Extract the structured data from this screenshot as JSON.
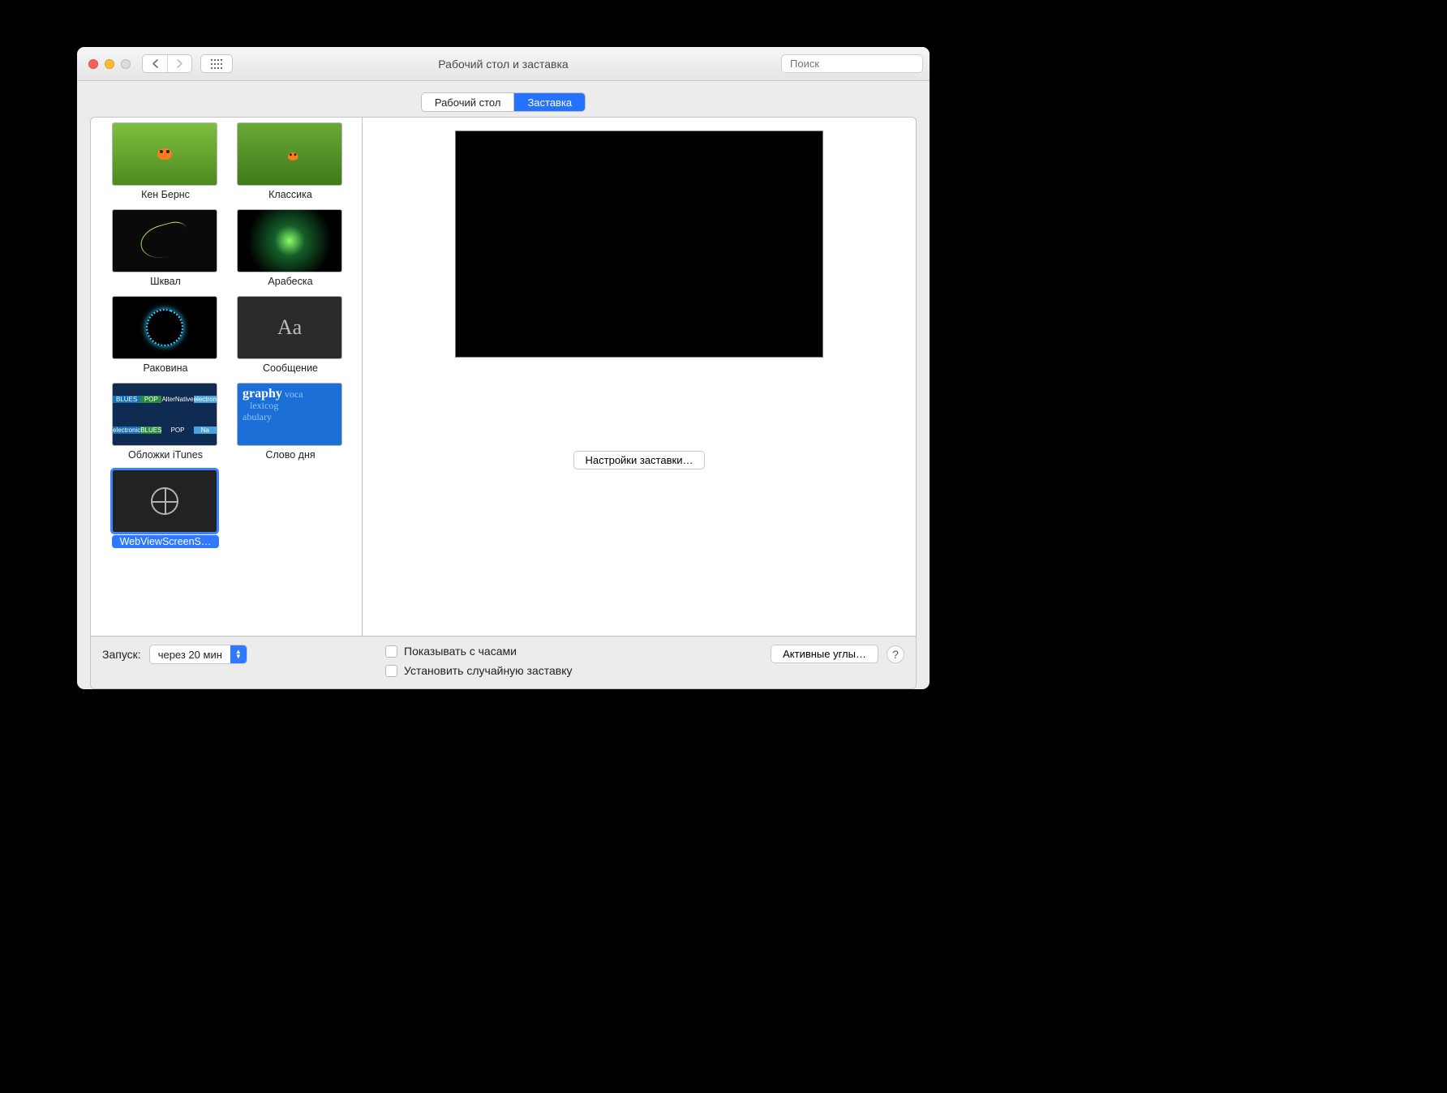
{
  "window": {
    "title": "Рабочий стол и заставка"
  },
  "search": {
    "placeholder": "Поиск"
  },
  "tabs": {
    "desktop": "Рабочий стол",
    "screensaver": "Заставка"
  },
  "savers": [
    {
      "label": "Кен Бернс",
      "kind": "green",
      "selected": false
    },
    {
      "label": "Классика",
      "kind": "green2",
      "selected": false
    },
    {
      "label": "Шквал",
      "kind": "flur",
      "selected": false
    },
    {
      "label": "Арабеска",
      "kind": "rays",
      "selected": false
    },
    {
      "label": "Раковина",
      "kind": "swirl",
      "selected": false
    },
    {
      "label": "Сообщение",
      "kind": "aa",
      "selected": false
    },
    {
      "label": "Обложки iTunes",
      "kind": "covers",
      "selected": false
    },
    {
      "label": "Слово дня",
      "kind": "word",
      "selected": false
    },
    {
      "label": "WebViewScreenS…",
      "kind": "globe",
      "selected": true
    }
  ],
  "options_button": "Настройки заставки…",
  "bottom": {
    "start_label": "Запуск:",
    "start_value": "через 20 мин",
    "show_clock": "Показывать с часами",
    "random": "Установить случайную заставку",
    "hot_corners": "Активные углы…"
  },
  "decor": {
    "aa": "Aa",
    "word_big": "graphy",
    "word_small1": "voca",
    "word_small2": "lexicog",
    "word_small3": "abulary",
    "cover_labels": [
      "BLUES",
      "POP",
      "AlterNative",
      "electron",
      "electronic",
      "BLUES",
      "POP",
      "Na"
    ]
  }
}
